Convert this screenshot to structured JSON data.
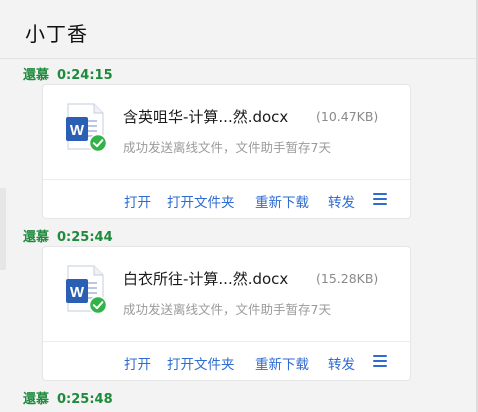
{
  "chat": {
    "title": "小丁香"
  },
  "messages": [
    {
      "sender": "還慕",
      "time": "0:24:15",
      "file": {
        "name": "含英咀华-计算...然.docx",
        "size": "(10.47KB)",
        "status": "成功发送离线文件，文件助手暂存7天",
        "icon": "word-doc-icon",
        "status_icon": "green-check-icon"
      },
      "actions": [
        "打开",
        "打开文件夹",
        "重新下载",
        "转发"
      ]
    },
    {
      "sender": "還慕",
      "time": "0:25:44",
      "file": {
        "name": "白衣所往-计算...然.docx",
        "size": "(15.28KB)",
        "status": "成功发送离线文件，文件助手暂存7天",
        "icon": "word-doc-icon",
        "status_icon": "green-check-icon"
      },
      "actions": [
        "打开",
        "打开文件夹",
        "重新下载",
        "转发"
      ]
    },
    {
      "sender": "還慕",
      "time": "0:25:48"
    }
  ],
  "colors": {
    "sender": "#1e8a3c",
    "link": "#2f6bd1",
    "word_blue": "#2b5fb4",
    "check_green": "#34b24a"
  }
}
